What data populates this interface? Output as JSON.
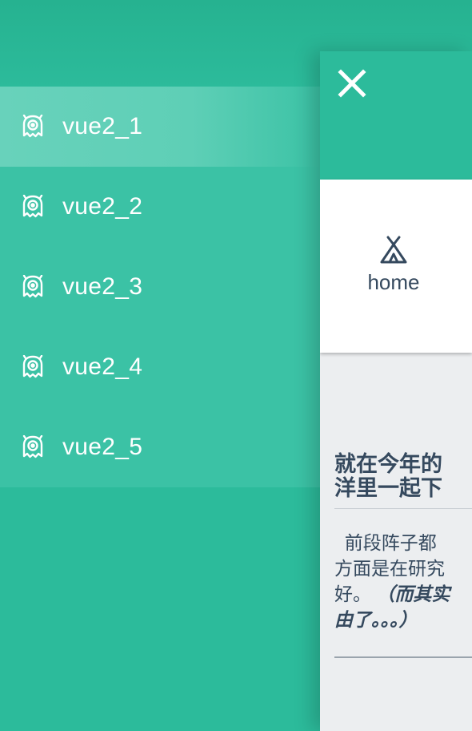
{
  "sidebar": {
    "items": [
      {
        "label": "vue2_1",
        "icon": "ghost-icon",
        "active": true
      },
      {
        "label": "vue2_2",
        "icon": "ghost-icon",
        "active": false
      },
      {
        "label": "vue2_3",
        "icon": "ghost-icon",
        "active": false
      },
      {
        "label": "vue2_4",
        "icon": "ghost-icon",
        "active": false
      },
      {
        "label": "vue2_5",
        "icon": "ghost-icon",
        "active": false
      }
    ]
  },
  "panel": {
    "close_icon": "close-icon",
    "tabs": [
      {
        "label": "home",
        "icon": "tent-icon"
      }
    ],
    "article": {
      "title_line1": "就在今年的",
      "title_line2": "洋里一起下",
      "body_line1": "  前段阵子都",
      "body_line2": "方面是在研究",
      "body_line3_plain": "好。",
      "body_line3_em": "（而其实",
      "body_line4_em": "由了。。。）"
    }
  },
  "colors": {
    "brand": "#2cbb9b",
    "menu_bg": "#3bc2a5",
    "active_item": "#68d2bb",
    "text_dark": "#35495e",
    "panel_bg": "#eceef0"
  }
}
